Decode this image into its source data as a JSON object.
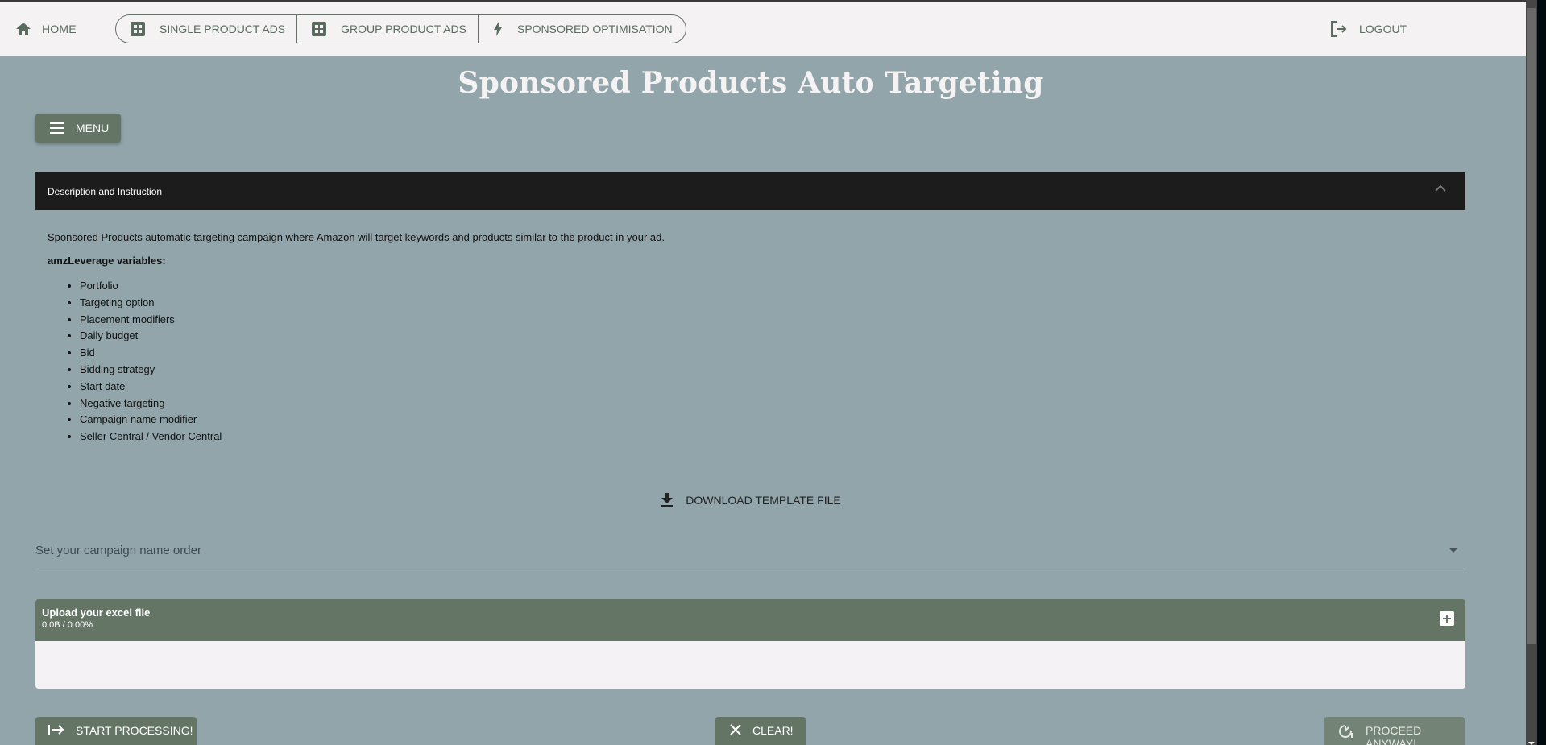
{
  "navbar": {
    "home": {
      "label": "HOME",
      "icon": "home-icon"
    },
    "nav_items": [
      {
        "label": "SINGLE PRODUCT ADS",
        "icon": "grid-icon"
      },
      {
        "label": "GROUP PRODUCT ADS",
        "icon": "grid-icon"
      },
      {
        "label": "SPONSORED OPTIMISATION",
        "icon": "lightning-icon"
      }
    ],
    "logout": {
      "label": "LOGOUT",
      "icon": "logout-icon"
    }
  },
  "page": {
    "title": "Sponsored Products Auto Targeting",
    "menu_label": "MENU"
  },
  "description": {
    "header": "Description and Instruction",
    "text": "Sponsored Products automatic targeting campaign where Amazon will target keywords and products similar to the product in your ad.",
    "variables_heading": "amzLeverage variables:",
    "variables": [
      "Portfolio",
      "Targeting option",
      "Placement modifiers",
      "Daily budget",
      "Bid",
      "Bidding strategy",
      "Start date",
      "Negative targeting",
      "Campaign name modifier",
      "Seller Central / Vendor Central"
    ]
  },
  "download": {
    "label": "DOWNLOAD TEMPLATE FILE"
  },
  "campaign_select": {
    "placeholder": "Set your campaign name order",
    "value": ""
  },
  "upload": {
    "title": "Upload your excel file",
    "status": "0.0B / 0.00%"
  },
  "actions": {
    "start": "START PROCESSING!",
    "clear": "CLEAR!",
    "proceed": "PROCEED ANYWAY!"
  },
  "colors": {
    "accent": "#647566",
    "background": "#91a5ab",
    "navbar": "#f4f2f2",
    "header_dark": "#1c1c1c"
  }
}
